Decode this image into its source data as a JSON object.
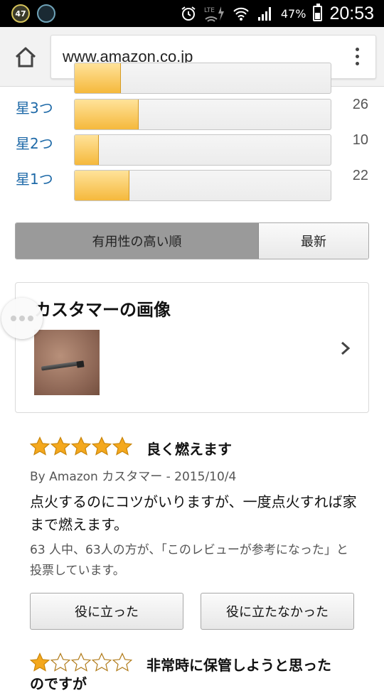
{
  "status_bar": {
    "badge1": "47",
    "badge2": "",
    "signal_label": "LTE",
    "battery_percent": "47%",
    "time": "20:53"
  },
  "browser": {
    "url": "www.amazon.co.jp"
  },
  "histogram": {
    "rows": [
      {
        "label": "星3つ",
        "count": "26",
        "fill": 0.25
      },
      {
        "label": "星2つ",
        "count": "10",
        "fill": 0.095
      },
      {
        "label": "星1つ",
        "count": "22",
        "fill": 0.215
      }
    ],
    "partial_top_fill": 0.18
  },
  "sort": {
    "helpful": "有用性の高い順",
    "newest": "最新"
  },
  "customer_images": {
    "title": "カスタマーの画像"
  },
  "reviews": [
    {
      "rating": 5,
      "title": "良く燃えます",
      "byline": "By Amazon カスタマー - 2015/10/4",
      "body": "点火するのにコツがいりますが、一度点火すれば家まで燃えます。",
      "helpful_text": "63 人中、63人の方が、「このレビューが参考になった」と投票しています。",
      "helpful_button": "役に立った",
      "not_helpful_button": "役に立たなかった"
    },
    {
      "rating": 1,
      "title": "非常時に保管しようと思った",
      "title_cont": "のですが"
    }
  ],
  "colors": {
    "star_fill": "#f4a81d",
    "histogram_fill": "#f5b93c",
    "link_blue": "#1f6aa8"
  }
}
